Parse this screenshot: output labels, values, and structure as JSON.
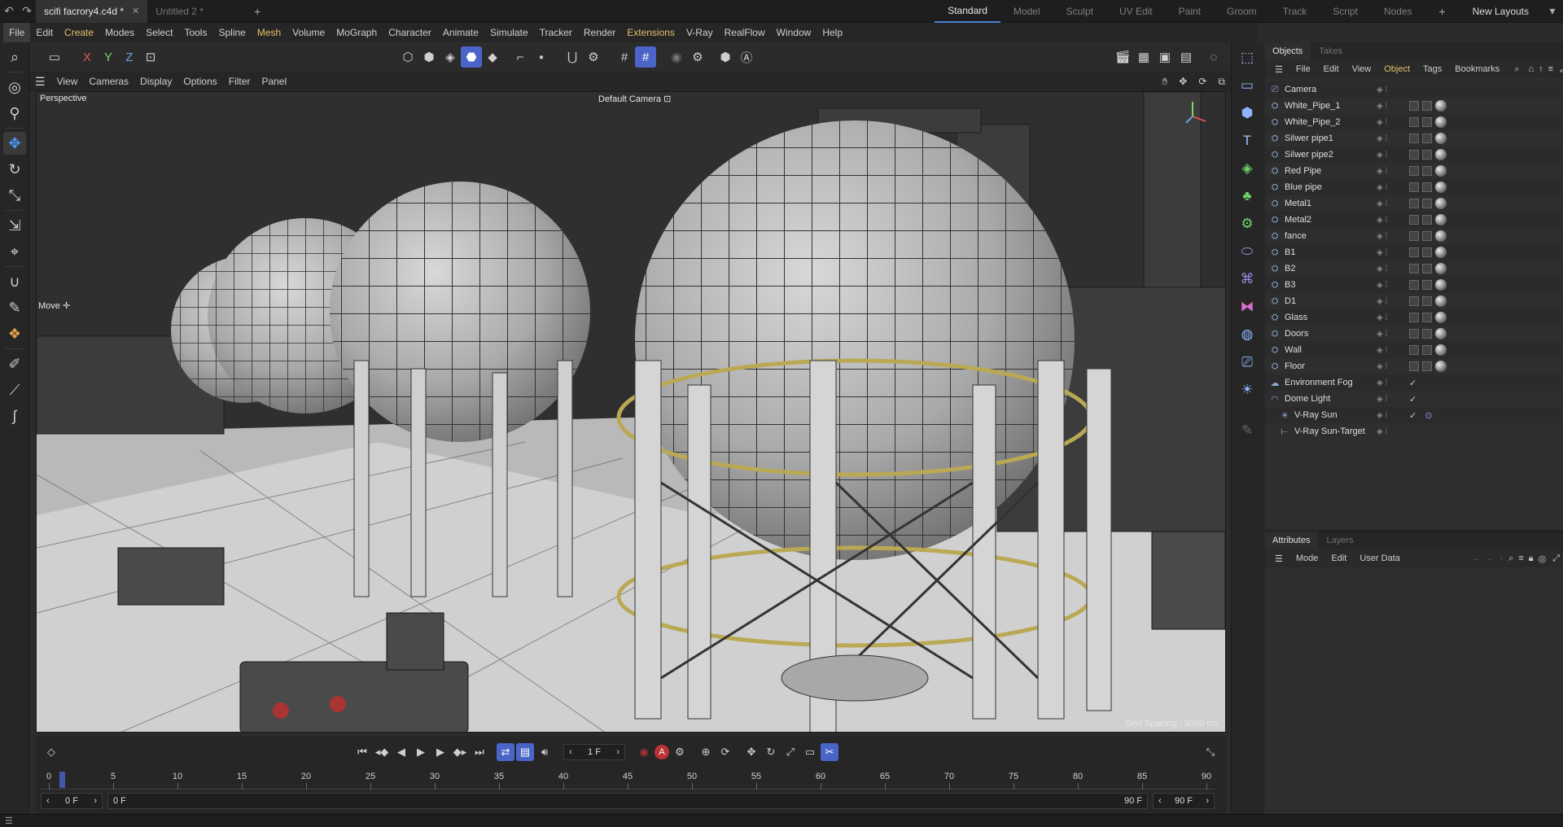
{
  "titlebar": {
    "tabs": [
      {
        "label": "scifi facrory4.c4d *",
        "active": true
      },
      {
        "label": "Untitled 2 *",
        "active": false
      }
    ],
    "layouts": [
      "Standard",
      "Model",
      "Sculpt",
      "UV Edit",
      "Paint",
      "Groom",
      "Track",
      "Script",
      "Nodes"
    ],
    "active_layout": "Standard",
    "new_layouts": "New Layouts"
  },
  "menubar": [
    "File",
    "Edit",
    "Create",
    "Modes",
    "Select",
    "Tools",
    "Spline",
    "Mesh",
    "Volume",
    "MoGraph",
    "Character",
    "Animate",
    "Simulate",
    "Tracker",
    "Render",
    "Extensions",
    "V-Ray",
    "RealFlow",
    "Window",
    "Help"
  ],
  "axes": {
    "x": "X",
    "y": "Y",
    "z": "Z"
  },
  "viewport_menu": [
    "View",
    "Cameras",
    "Display",
    "Options",
    "Filter",
    "Panel"
  ],
  "viewport": {
    "projection": "Perspective",
    "camera": "Default Camera",
    "tool": "Move",
    "grid_spacing": "Grid Spacing : 5000 cm"
  },
  "objects_panel": {
    "tabs": [
      "Objects",
      "Takes"
    ],
    "menu": [
      "File",
      "Edit",
      "View",
      "Object",
      "Tags",
      "Bookmarks"
    ],
    "items": [
      {
        "name": "Camera",
        "icon": "camera-icon",
        "tag": "none"
      },
      {
        "name": "White_Pipe_1",
        "icon": "null-object-icon",
        "tag": "mat"
      },
      {
        "name": "White_Pipe_2",
        "icon": "null-object-icon",
        "tag": "mat"
      },
      {
        "name": "Silwer pipe1",
        "icon": "null-object-icon",
        "tag": "mat"
      },
      {
        "name": "Silwer pipe2",
        "icon": "null-object-icon",
        "tag": "mat"
      },
      {
        "name": "Red Pipe",
        "icon": "null-object-icon",
        "tag": "mat"
      },
      {
        "name": "Blue pipe",
        "icon": "null-object-icon",
        "tag": "mat"
      },
      {
        "name": "Metal1",
        "icon": "null-object-icon",
        "tag": "mat"
      },
      {
        "name": "Metal2",
        "icon": "null-object-icon",
        "tag": "mat"
      },
      {
        "name": "fance",
        "icon": "null-object-icon",
        "tag": "mat"
      },
      {
        "name": "B1",
        "icon": "null-object-icon",
        "tag": "mat"
      },
      {
        "name": "B2",
        "icon": "null-object-icon",
        "tag": "mat"
      },
      {
        "name": "B3",
        "icon": "null-object-icon",
        "tag": "mat"
      },
      {
        "name": "D1",
        "icon": "null-object-icon",
        "tag": "mat"
      },
      {
        "name": "Glass",
        "icon": "null-object-icon",
        "tag": "mat"
      },
      {
        "name": "Doors",
        "icon": "null-object-icon",
        "tag": "mat"
      },
      {
        "name": "Wall",
        "icon": "null-object-icon",
        "tag": "mat"
      },
      {
        "name": "Floor",
        "icon": "null-object-icon",
        "tag": "mat"
      },
      {
        "name": "Environment Fog",
        "icon": "fog-icon",
        "tag": "check"
      },
      {
        "name": "Dome Light",
        "icon": "dome-light-icon",
        "tag": "check"
      },
      {
        "name": "V-Ray Sun",
        "icon": "sun-icon",
        "tag": "check-target"
      },
      {
        "name": "V-Ray Sun-Target",
        "icon": "target-icon",
        "tag": "none"
      }
    ]
  },
  "attributes_panel": {
    "tabs": [
      "Attributes",
      "Layers"
    ],
    "menu": [
      "Mode",
      "Edit",
      "User Data"
    ]
  },
  "timeline": {
    "current_frame": "1 F",
    "start_frame": "0 F",
    "range_start": "0 F",
    "range_end": "90 F",
    "end_frame": "90 F",
    "ticks": [
      "0",
      "5",
      "10",
      "15",
      "20",
      "25",
      "30",
      "35",
      "40",
      "45",
      "50",
      "55",
      "60",
      "65",
      "70",
      "75",
      "80",
      "85",
      "90"
    ]
  },
  "colors": {
    "accent": "#4a64c8",
    "highlight_menu": "#e3c06a",
    "background": "#2b2b2b"
  }
}
